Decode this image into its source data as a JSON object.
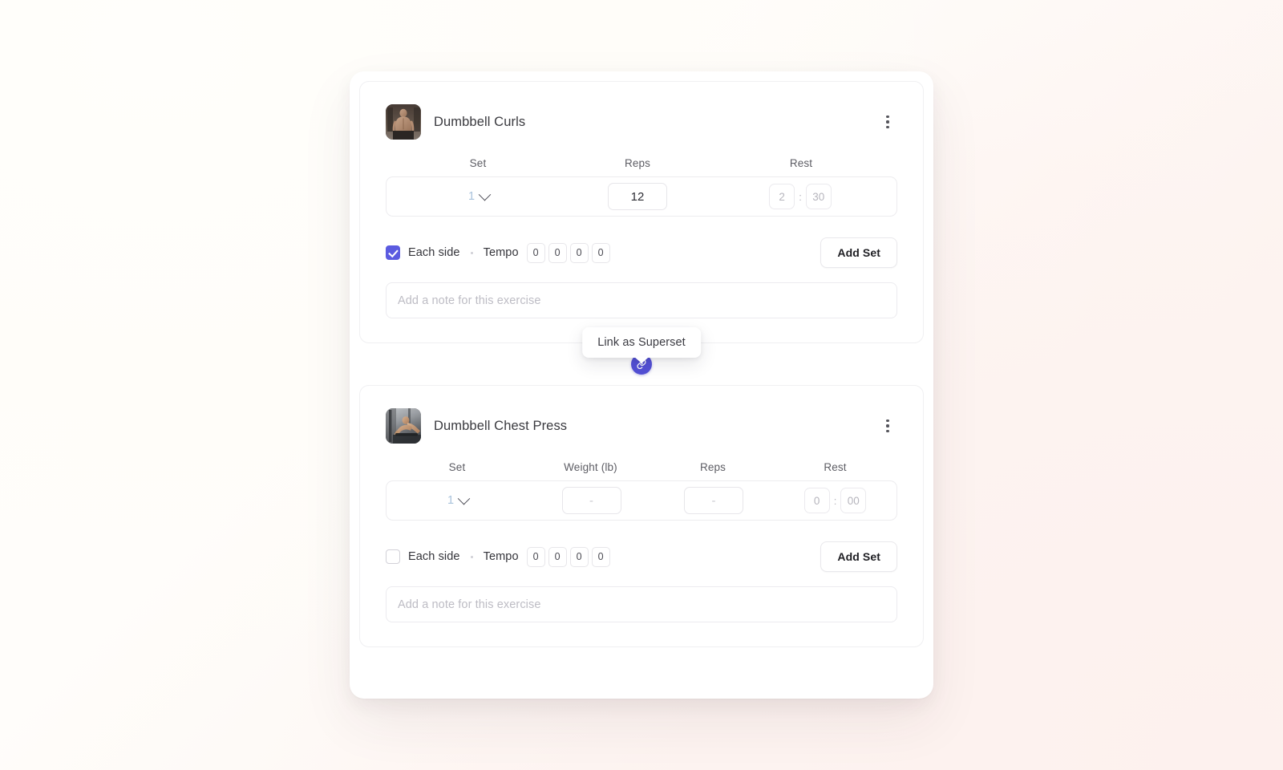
{
  "theme": {
    "accent": "#5350d6",
    "checkbox_checked": "#5b5be0",
    "card_bg": "#ffffff",
    "page_bg_start": "#fffefb",
    "page_bg_end": "#fcf0ec",
    "text_primary": "#3a3a3f",
    "text_muted": "#bdbcc4",
    "set_number_color": "#a9c3dc"
  },
  "connector": {
    "tooltip_label": "Link as Superset",
    "button_icon": "link-icon"
  },
  "exercises": [
    {
      "title": "Dumbbell Curls",
      "thumbnail_alt": "dumbbell-curls-thumbnail",
      "menu_icon": "kebab-menu-icon",
      "columns": [
        "Set",
        "Reps",
        "Rest"
      ],
      "sets": [
        {
          "set_number": "1",
          "reps": "12",
          "reps_is_placeholder": false,
          "rest_minutes": "2",
          "rest_seconds": "30",
          "rest_separator": ":"
        }
      ],
      "options": {
        "each_side_label": "Each side",
        "each_side_checked": true,
        "tempo_label": "Tempo",
        "tempo_values": [
          "0",
          "0",
          "0",
          "0"
        ],
        "add_set_label": "Add Set"
      },
      "note_placeholder": "Add a note for this exercise",
      "note_value": ""
    },
    {
      "title": "Dumbbell Chest Press",
      "thumbnail_alt": "dumbbell-chest-press-thumbnail",
      "menu_icon": "kebab-menu-icon",
      "columns": [
        "Set",
        "Weight (lb)",
        "Reps",
        "Rest"
      ],
      "sets": [
        {
          "set_number": "1",
          "weight": "-",
          "weight_is_placeholder": true,
          "reps": "-",
          "reps_is_placeholder": true,
          "rest_minutes": "0",
          "rest_seconds": "00",
          "rest_separator": ":"
        }
      ],
      "options": {
        "each_side_label": "Each side",
        "each_side_checked": false,
        "tempo_label": "Tempo",
        "tempo_values": [
          "0",
          "0",
          "0",
          "0"
        ],
        "add_set_label": "Add Set"
      },
      "note_placeholder": "Add a note for this exercise",
      "note_value": ""
    }
  ]
}
